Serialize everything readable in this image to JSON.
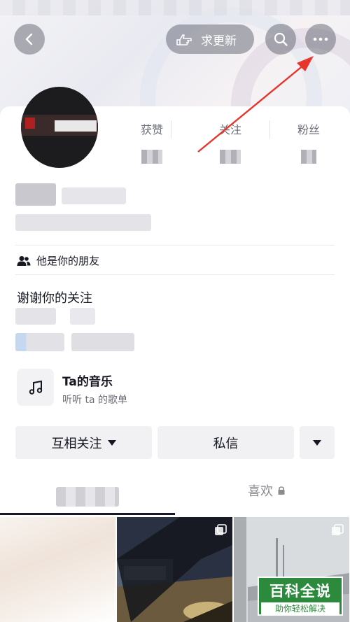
{
  "header": {
    "update_label": "求更新"
  },
  "stats": [
    {
      "label": "获赞"
    },
    {
      "label": "关注"
    },
    {
      "label": "粉丝"
    }
  ],
  "friend_tag": "他是你的朋友",
  "bio": "谢谢你的关注",
  "music": {
    "title": "Ta的音乐",
    "subtitle": "听听 ta 的歌单"
  },
  "actions": {
    "follow_label": "互相关注",
    "message_label": "私信"
  },
  "tabs": {
    "likes_label": "喜欢"
  },
  "watermark": {
    "brand": "百科全说",
    "slogan": "助你轻松解决"
  },
  "colors": {
    "annotation_arrow": "#e8342b",
    "watermark_green": "#2b8a3b"
  }
}
